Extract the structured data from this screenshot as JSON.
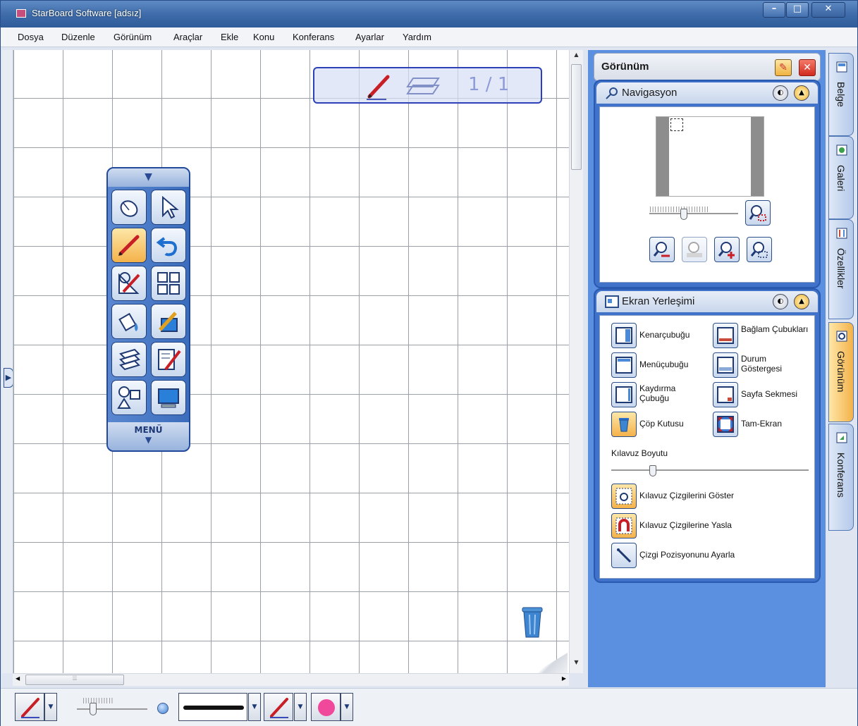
{
  "window": {
    "title": "StarBoard Software [adsız]"
  },
  "menu": [
    "Dosya",
    "Düzenle",
    "Görünüm",
    "Araçlar",
    "Ekle",
    "Konu",
    "Konferans",
    "Ayarlar",
    "Yardım"
  ],
  "page_indicator": {
    "value": "1 / 1"
  },
  "toolbar": {
    "menu_label": "MENÜ"
  },
  "panel": {
    "title": "Görünüm",
    "navigation": {
      "title": "Navigasyon"
    },
    "screen_layout": {
      "title": "Ekran Yerleşimi",
      "items": [
        {
          "label": "Kenarçubuğu",
          "icon": "sidebar-icon",
          "active": false
        },
        {
          "label": "Bağlam Çubukları",
          "icon": "context-bars-icon",
          "active": false
        },
        {
          "label": "Menüçubuğu",
          "icon": "menubar-icon",
          "active": false
        },
        {
          "label": "Durum Göstergesi",
          "icon": "status-indicator-icon",
          "active": false
        },
        {
          "label": "Kaydırma Çubuğu",
          "icon": "scrollbar-icon",
          "active": false
        },
        {
          "label": "Sayfa Sekmesi",
          "icon": "page-tab-icon",
          "active": false
        },
        {
          "label": "Çöp Kutusu",
          "icon": "trash-icon",
          "active": true
        },
        {
          "label": "Tam-Ekran",
          "icon": "fullscreen-icon",
          "active": false
        }
      ],
      "guide_size_label": "Kılavuz Boyutu",
      "guide_items": [
        {
          "label": "Kılavuz Çizgilerini Göster",
          "icon": "show-grid-icon",
          "active": true
        },
        {
          "label": "Kılavuz Çizgilerine Yasla",
          "icon": "snap-grid-icon",
          "active": true
        },
        {
          "label": "Çizgi Pozisyonunu Ayarla",
          "icon": "line-position-icon",
          "active": false
        }
      ]
    }
  },
  "tabs": [
    "Belge",
    "Galeri",
    "Özellikler",
    "Görünüm",
    "Konferans"
  ],
  "colors": {
    "accent": "#5b8fe0",
    "active": "#f4b24a",
    "pen": "#d0202a",
    "fill_color": "#f0489a"
  }
}
